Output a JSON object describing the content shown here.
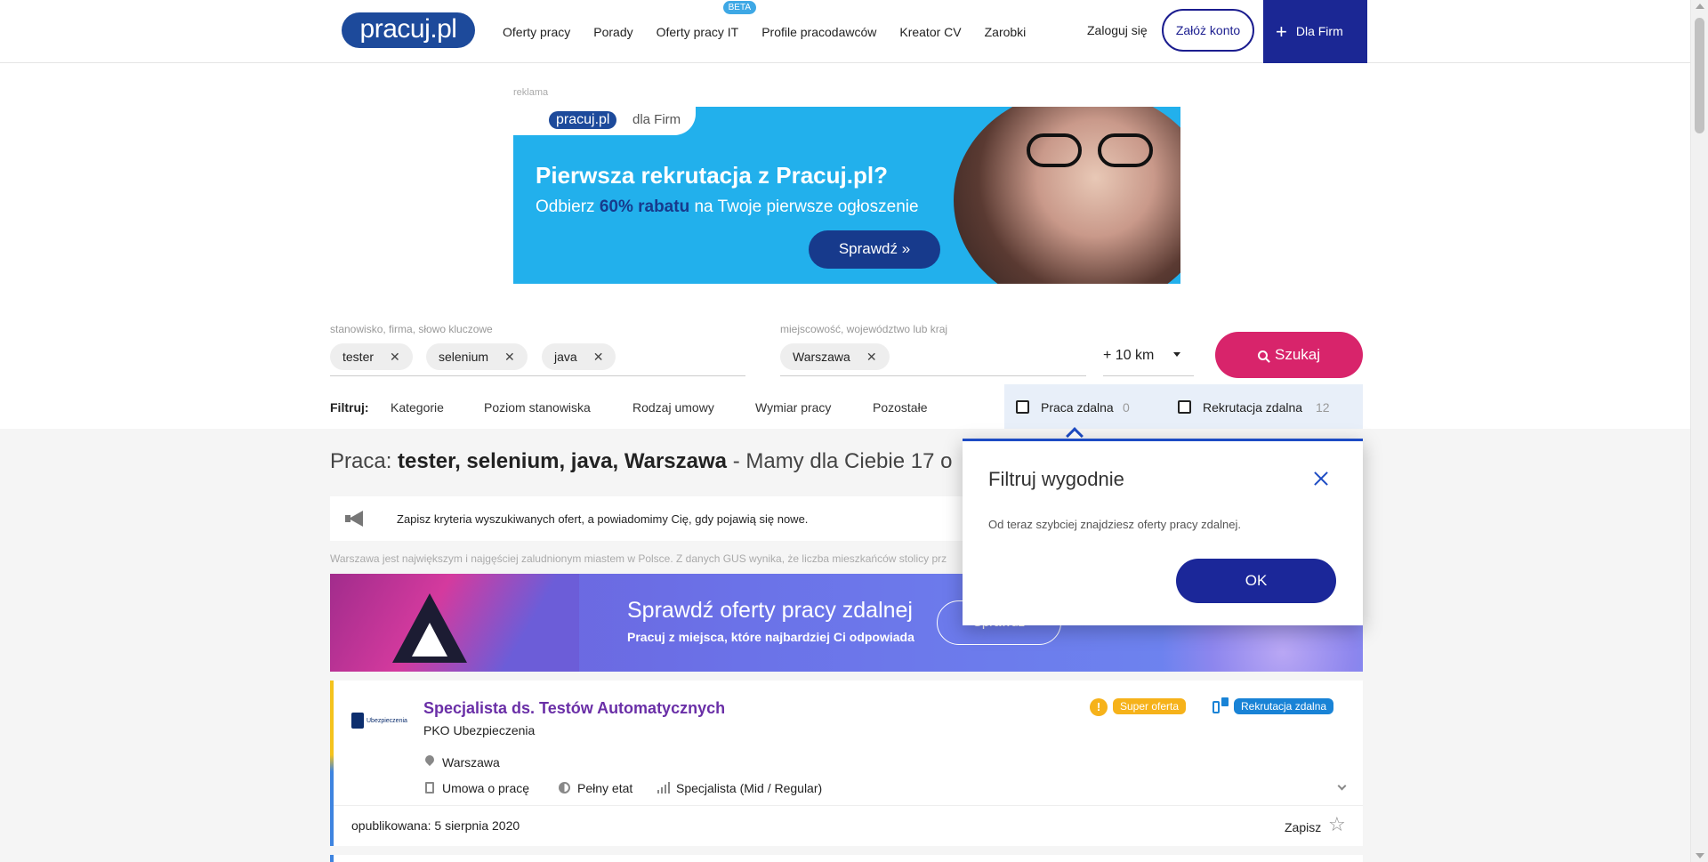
{
  "header": {
    "logo": "pracuj.pl",
    "nav": [
      "Oferty pracy",
      "Porady",
      "Oferty pracy IT",
      "Profile pracodawców",
      "Kreator CV",
      "Zarobki"
    ],
    "beta_badge": "BETA",
    "login": "Zaloguj się",
    "register": "Załóż konto",
    "for_firms": "Dla Firm"
  },
  "ad": {
    "label": "reklama",
    "logo": "pracuj.pl",
    "logo_suffix": "dla Firm",
    "headline": "Pierwsza rekrutacja z Pracuj.pl?",
    "sub_before": "Odbierz",
    "sub_bold": "60% rabatu",
    "sub_after": "na Twoje pierwsze ogłoszenie",
    "button": "Sprawdź »"
  },
  "search": {
    "keyword_label": "stanowisko, firma, słowo kluczowe",
    "keyword_chips": [
      "tester",
      "selenium",
      "java"
    ],
    "location_label": "miejscowość, województwo lub kraj",
    "location_chips": [
      "Warszawa"
    ],
    "distance": "+ 10 km",
    "button": "Szukaj"
  },
  "filters": {
    "label": "Filtruj:",
    "items": [
      "Kategorie",
      "Poziom stanowiska",
      "Rodzaj umowy",
      "Wymiar pracy",
      "Pozostałe"
    ],
    "remote_work": {
      "label": "Praca zdalna",
      "count": "0",
      "checked": false
    },
    "remote_recruitment": {
      "label": "Rekrutacja zdalna",
      "count": "12",
      "checked": false
    }
  },
  "results": {
    "prefix": "Praca:",
    "query": "tester, selenium, java, Warszawa",
    "suffix": "- Mamy dla Ciebie 17 o",
    "save_text": "Zapisz kryteria wyszukiwanych ofert, a powiadomimy Cię, gdy pojawią się nowe.",
    "city_note": "Warszawa jest największym i najgęściej zaludnionym miastem w Polsce. Z danych GUS wynika, że liczba mieszkańców stolicy prz"
  },
  "remote_banner": {
    "title": "Sprawdź oferty pracy zdalnej",
    "subtitle": "Pracuj z miejsca, które najbardziej Ci odpowiada",
    "button": "Sprawdź"
  },
  "job": {
    "company_logo_text": "Ubezpieczenia",
    "title": "Specjalista ds. Testów Automatycznych",
    "company": "PKO Ubezpieczenia",
    "location": "Warszawa",
    "contract": "Umowa o pracę",
    "time": "Pełny etat",
    "level": "Specjalista (Mid / Regular)",
    "badge_super": "Super oferta",
    "badge_super_icon": "!",
    "badge_remote": "Rekrutacja zdalna",
    "published": "opublikowana: 5 sierpnia 2020",
    "save": "Zapisz"
  },
  "popup": {
    "title": "Filtruj wygodnie",
    "text": "Od teraz szybciej znajdziesz oferty pracy zdalnej.",
    "ok": "OK"
  },
  "colors": {
    "brand_blue": "#1d4a9b",
    "accent_pink": "#d8246b",
    "navy": "#1b2794",
    "job_title": "#6a2fa7"
  }
}
